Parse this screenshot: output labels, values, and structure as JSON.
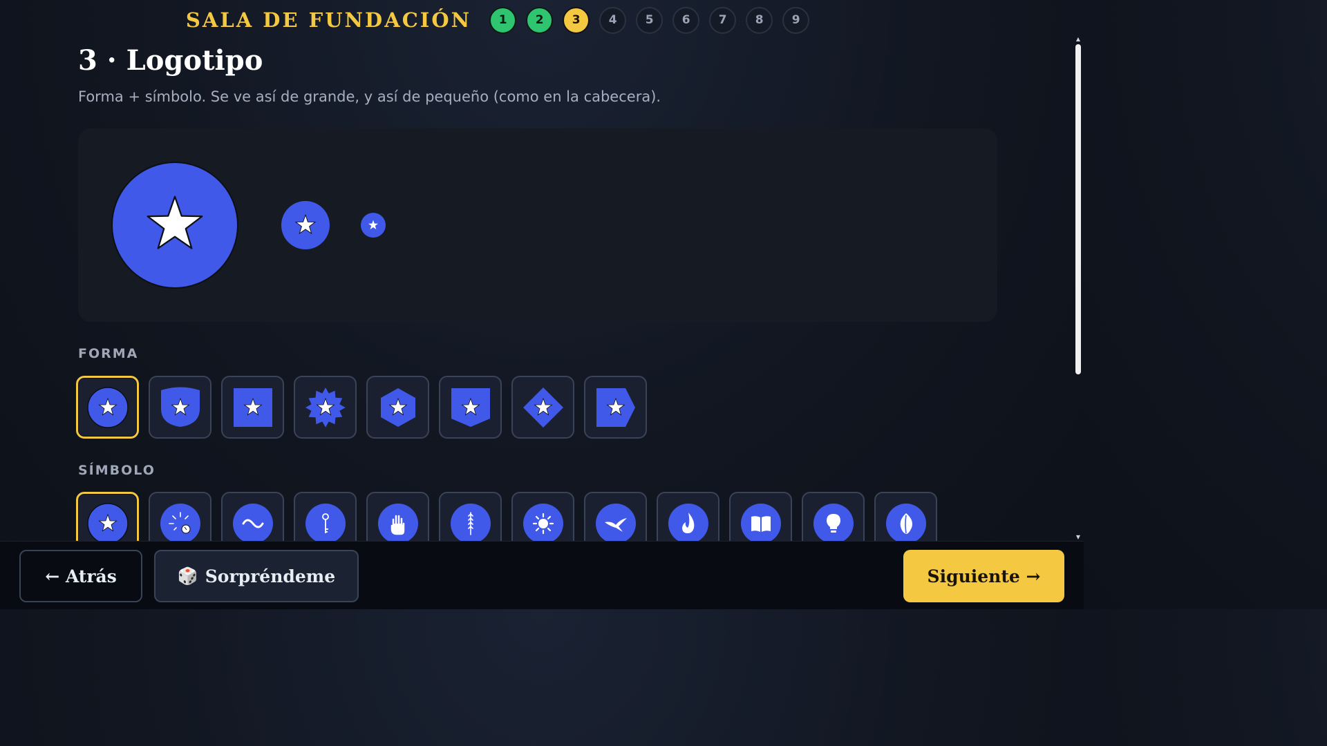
{
  "header": {
    "brand": "SALA DE FUNDACIÓN",
    "steps": [
      "1",
      "2",
      "3",
      "4",
      "5",
      "6",
      "7",
      "8",
      "9"
    ],
    "current_step": 3
  },
  "page": {
    "title": "3 · Logotipo",
    "subtitle": "Forma + símbolo. Se ve así de grande, y así de pequeño (como en la cabecera)."
  },
  "form_section": {
    "label": "FORMA",
    "options": [
      "circle",
      "shield",
      "square",
      "seal",
      "hexagon",
      "banner",
      "diamond",
      "arrow"
    ],
    "selected": "circle"
  },
  "symbol_section": {
    "label": "SÍMBOLO",
    "options": [
      "star-icon",
      "spark-icon",
      "wave-icon",
      "key-icon",
      "hand-icon",
      "wheat-icon",
      "sun-icon",
      "bird-icon",
      "flame-icon",
      "book-icon",
      "bulb-icon",
      "leaf-icon"
    ],
    "selected": "star-icon"
  },
  "footer": {
    "back_label": "← Atrás",
    "surprise_label": "Sorpréndeme",
    "surprise_icon": "dice-icon",
    "next_label": "Siguiente →"
  },
  "colors": {
    "accent": "#f5c842",
    "logo": "#4059e8",
    "done": "#2fc46f"
  }
}
